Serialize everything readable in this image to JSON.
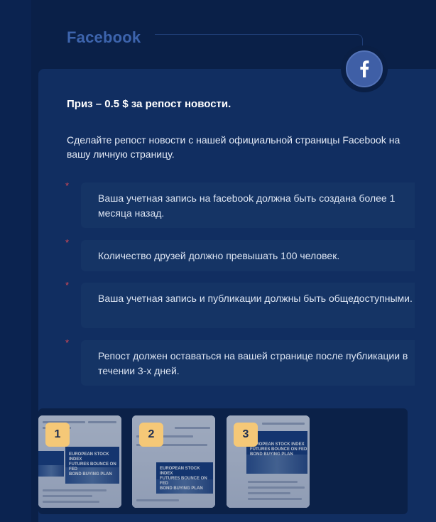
{
  "header": {
    "title": "Facebook",
    "icon": "facebook-icon"
  },
  "task": {
    "prize": "Приз – 0.5 $ за репост новости.",
    "intro": "Сделайте репост новости с нашей официальной страницы Facebook на вашу личную страницу.",
    "bullet_marker": "*",
    "requirements": [
      "Ваша учетная запись на facebook должна быть создана более 1 месяца назад.",
      "Количество друзей должно превышать 100 человек.",
      "Ваша учетная запись и публикации должны быть общедоступными.",
      "Репост должен оставаться на вашей странице после публикации в течении 3-х дней."
    ]
  },
  "gallery": {
    "thumbnails": [
      {
        "number": "1",
        "banner_text": "EUROPEAN STOCK INDEX\nFUTURES BOUNCE ON FED\nBOND BUYING PLAN"
      },
      {
        "number": "2",
        "banner_text": "EUROPEAN STOCK INDEX\nFUTURES BOUNCE ON FED\nBOND BUYING PLAN"
      },
      {
        "number": "3",
        "banner_text": "EUROPEAN STOCK INDEX\nFUTURES BOUNCE ON FED\nBOND BUYING PLAN"
      }
    ]
  },
  "colors": {
    "background": "#0b2350",
    "card": "#112e61",
    "title_blue": "#3d64ad",
    "facebook_blue": "#3f5fa6",
    "bullet_red": "#d64a57",
    "badge_yellow": "#f5c877"
  }
}
